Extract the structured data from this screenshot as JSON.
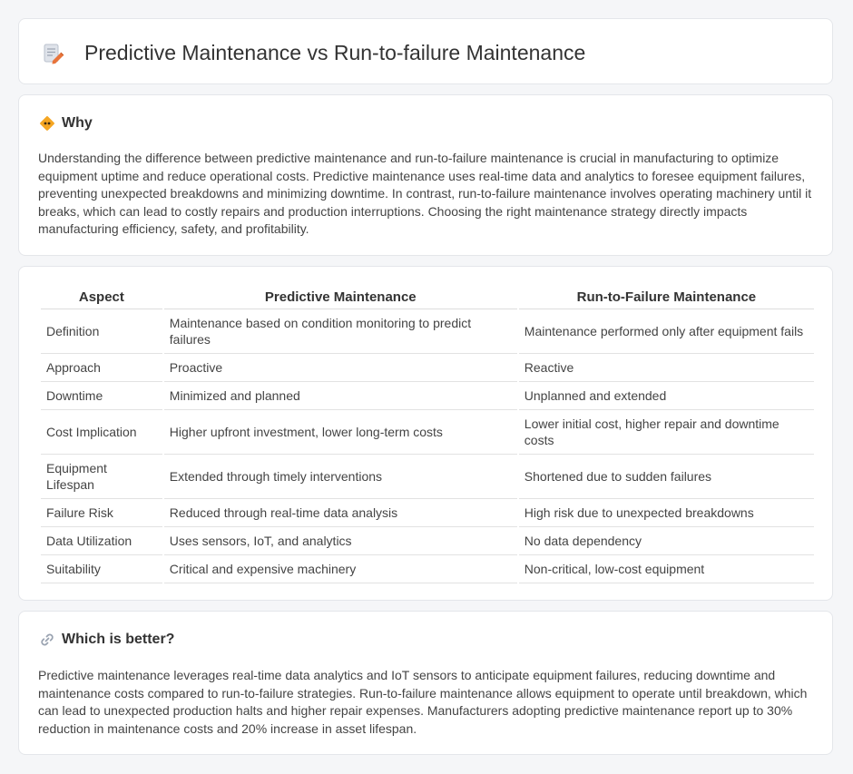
{
  "header": {
    "title": "Predictive Maintenance vs Run-to-failure Maintenance",
    "icon": "document-pencil-icon"
  },
  "why": {
    "title": "Why",
    "icon": "warning-sign-icon",
    "body": "Understanding the difference between predictive maintenance and run-to-failure maintenance is crucial in manufacturing to optimize equipment uptime and reduce operational costs. Predictive maintenance uses real-time data and analytics to foresee equipment failures, preventing unexpected breakdowns and minimizing downtime. In contrast, run-to-failure maintenance involves operating machinery until it breaks, which can lead to costly repairs and production interruptions. Choosing the right maintenance strategy directly impacts manufacturing efficiency, safety, and profitability."
  },
  "comparison": {
    "headers": [
      "Aspect",
      "Predictive Maintenance",
      "Run-to-Failure Maintenance"
    ],
    "rows": [
      [
        "Definition",
        "Maintenance based on condition monitoring to predict failures",
        "Maintenance performed only after equipment fails"
      ],
      [
        "Approach",
        "Proactive",
        "Reactive"
      ],
      [
        "Downtime",
        "Minimized and planned",
        "Unplanned and extended"
      ],
      [
        "Cost Implication",
        "Higher upfront investment, lower long-term costs",
        "Lower initial cost, higher repair and downtime costs"
      ],
      [
        "Equipment Lifespan",
        "Extended through timely interventions",
        "Shortened due to sudden failures"
      ],
      [
        "Failure Risk",
        "Reduced through real-time data analysis",
        "High risk due to unexpected breakdowns"
      ],
      [
        "Data Utilization",
        "Uses sensors, IoT, and analytics",
        "No data dependency"
      ],
      [
        "Suitability",
        "Critical and expensive machinery",
        "Non-critical, low-cost equipment"
      ]
    ]
  },
  "better": {
    "title": "Which is better?",
    "icon": "link-icon",
    "body": "Predictive maintenance leverages real-time data analytics and IoT sensors to anticipate equipment failures, reducing downtime and maintenance costs compared to run-to-failure strategies. Run-to-failure maintenance allows equipment to operate until breakdown, which can lead to unexpected production halts and higher repair expenses. Manufacturers adopting predictive maintenance report up to 30% reduction in maintenance costs and 20% increase in asset lifespan."
  },
  "colors": {
    "background": "#f5f6f8",
    "card": "#ffffff",
    "border": "#e4e6ea",
    "text": "#333333",
    "icon_accent": "#f5a623",
    "icon_pencil": "#e8743b"
  }
}
